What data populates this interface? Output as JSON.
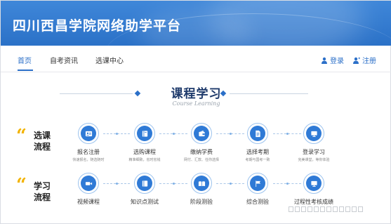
{
  "header": {
    "site_title": "四川西昌学院网络助学平台"
  },
  "nav": {
    "items": [
      {
        "label": "首页",
        "active": true
      },
      {
        "label": "自考资讯",
        "active": false
      },
      {
        "label": "选课中心",
        "active": false
      }
    ],
    "login_label": "登录",
    "register_label": "注册"
  },
  "section": {
    "title": "课程学习",
    "subtitle": "Course Learning"
  },
  "course_flow": {
    "label_line1": "选课",
    "label_line2": "流程",
    "steps": [
      {
        "label": "报名注册",
        "desc": "快速报名，随选随时",
        "icon": "id-card-icon"
      },
      {
        "label": "选购课程",
        "desc": "精准细致，省时省钱",
        "icon": "book-icon"
      },
      {
        "label": "缴纳学费",
        "desc": "网付、汇款、任你选择",
        "icon": "wallet-icon"
      },
      {
        "label": "选择考期",
        "desc": "考期与国考一致",
        "icon": "document-icon"
      },
      {
        "label": "登录学习",
        "desc": "完美课堂，等你体验",
        "icon": "monitor-icon"
      }
    ]
  },
  "study_flow": {
    "label_line1": "学习",
    "label_line2": "流程",
    "steps": [
      {
        "label": "视频课程",
        "icon": "video-icon"
      },
      {
        "label": "知识点测试",
        "icon": "book-icon"
      },
      {
        "label": "阶段测验",
        "icon": "open-book-icon"
      },
      {
        "label": "综合测验",
        "icon": "flag-icon"
      },
      {
        "label": "过程性考核成绩",
        "icon": "monitor-icon"
      }
    ]
  },
  "colors": {
    "brand_blue": "#2b6fc8",
    "accent_yellow": "#f2b300",
    "icon_blue": "#2f7ad6"
  }
}
